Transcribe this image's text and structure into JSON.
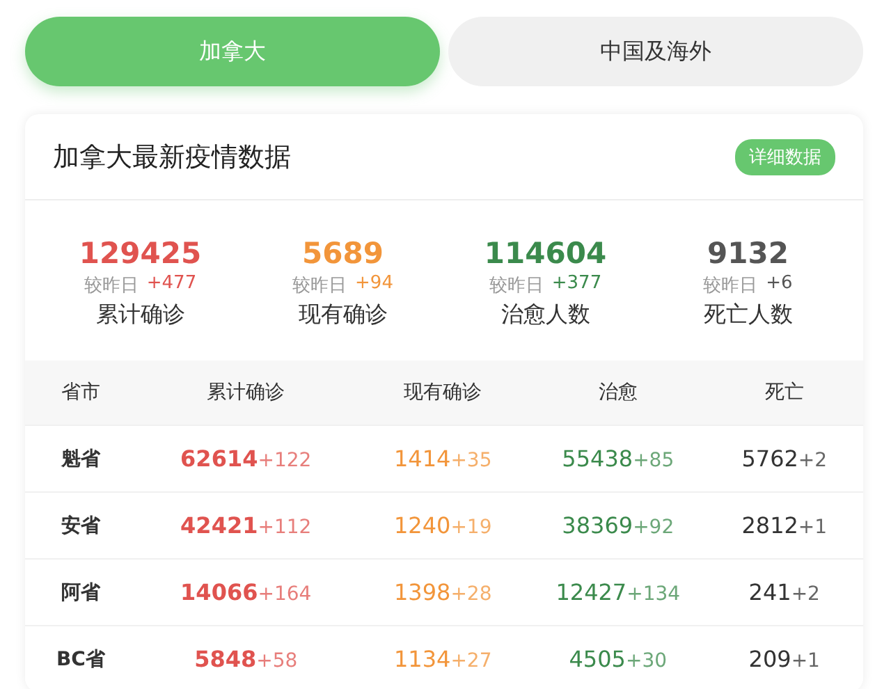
{
  "tabs": [
    {
      "label": "加拿大",
      "selected": true
    },
    {
      "label": "中国及海外",
      "selected": false
    }
  ],
  "card": {
    "title": "加拿大最新疫情数据",
    "detail_button": "详细数据"
  },
  "stats": [
    {
      "value": "129425",
      "compare_label": "较昨日",
      "delta": "+477",
      "label": "累计确诊",
      "color": "#e0534f"
    },
    {
      "value": "5689",
      "compare_label": "较昨日",
      "delta": "+94",
      "label": "现有确诊",
      "color": "#f2953a"
    },
    {
      "value": "114604",
      "compare_label": "较昨日",
      "delta": "+377",
      "label": "治愈人数",
      "color": "#3b8a4c"
    },
    {
      "value": "9132",
      "compare_label": "较昨日",
      "delta": "+6",
      "label": "死亡人数",
      "color": "#555555"
    }
  ],
  "table": {
    "columns": [
      {
        "label": "省市"
      },
      {
        "label": "累计确诊",
        "color": "#e0534f"
      },
      {
        "label": "现有确诊",
        "color": "#f2953a"
      },
      {
        "label": "治愈",
        "color": "#3b8a4c"
      },
      {
        "label": "死亡",
        "color": "#333333"
      }
    ],
    "rows": [
      {
        "cells": [
          {
            "value": "魁省"
          },
          {
            "value": "62614",
            "delta": "+122"
          },
          {
            "value": "1414",
            "delta": "+35"
          },
          {
            "value": "55438",
            "delta": "+85"
          },
          {
            "value": "5762",
            "delta": "+2"
          }
        ]
      },
      {
        "cells": [
          {
            "value": "安省"
          },
          {
            "value": "42421",
            "delta": "+112"
          },
          {
            "value": "1240",
            "delta": "+19"
          },
          {
            "value": "38369",
            "delta": "+92"
          },
          {
            "value": "2812",
            "delta": "+1"
          }
        ]
      },
      {
        "cells": [
          {
            "value": "阿省"
          },
          {
            "value": "14066",
            "delta": "+164"
          },
          {
            "value": "1398",
            "delta": "+28"
          },
          {
            "value": "12427",
            "delta": "+134"
          },
          {
            "value": "241",
            "delta": "+2"
          }
        ]
      },
      {
        "cells": [
          {
            "value": "BC省"
          },
          {
            "value": "5848",
            "delta": "+58"
          },
          {
            "value": "1134",
            "delta": "+27"
          },
          {
            "value": "4505",
            "delta": "+30"
          },
          {
            "value": "209",
            "delta": "+1"
          }
        ]
      }
    ]
  }
}
